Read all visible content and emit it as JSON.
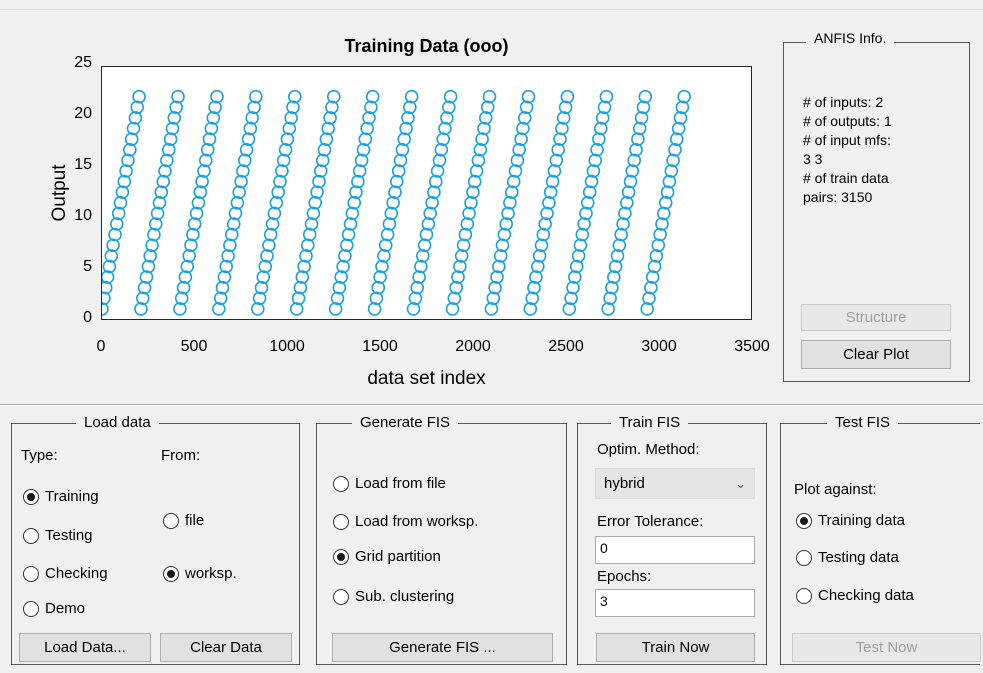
{
  "plot": {
    "title": "Training Data (ooo)",
    "xlabel": "data set index",
    "ylabel": "Output",
    "x_ticks": [
      "0",
      "500",
      "1000",
      "1500",
      "2000",
      "2500",
      "3000",
      "3500"
    ],
    "y_ticks": [
      "0",
      "5",
      "10",
      "15",
      "20",
      "25"
    ]
  },
  "chart_data": {
    "type": "scatter",
    "title": "Training Data (ooo)",
    "xlabel": "data set index",
    "ylabel": "Output",
    "xlim": [
      0,
      3500
    ],
    "ylim": [
      0,
      25
    ],
    "marker": "circle",
    "color": "#1ba1e2",
    "n_points": 3150,
    "pattern": "15 repeated ramps, each 210 points with output rising from 1 to 23"
  },
  "anfis_info": {
    "title": "ANFIS Info.",
    "inputs": "# of inputs: 2",
    "outputs": "# of outputs: 1",
    "input_mfs_label": "# of input mfs:",
    "input_mfs_value": "3  3",
    "train_pairs_label": "# of train data",
    "train_pairs_value": "pairs: 3150",
    "structure_button": "Structure",
    "clear_plot_button": "Clear Plot"
  },
  "load_data": {
    "title": "Load data",
    "type_label": "Type:",
    "from_label": "From:",
    "type_options": [
      "Training",
      "Testing",
      "Checking",
      "Demo"
    ],
    "type_selected": "Training",
    "from_options": [
      "file",
      "worksp."
    ],
    "from_selected": "worksp.",
    "load_button": "Load Data...",
    "clear_button": "Clear Data"
  },
  "generate_fis": {
    "title": "Generate FIS",
    "options": [
      "Load from file",
      "Load from worksp.",
      "Grid partition",
      "Sub. clustering"
    ],
    "selected": "Grid partition",
    "button": "Generate FIS ..."
  },
  "train_fis": {
    "title": "Train FIS",
    "optim_label": "Optim. Method:",
    "optim_value": "hybrid",
    "error_label": "Error Tolerance:",
    "error_value": "0",
    "epochs_label": "Epochs:",
    "epochs_value": "3",
    "button": "Train Now"
  },
  "test_fis": {
    "title": "Test FIS",
    "plot_against_label": "Plot against:",
    "options": [
      "Training data",
      "Testing data",
      "Checking data"
    ],
    "selected": "Training data",
    "button": "Test Now"
  }
}
